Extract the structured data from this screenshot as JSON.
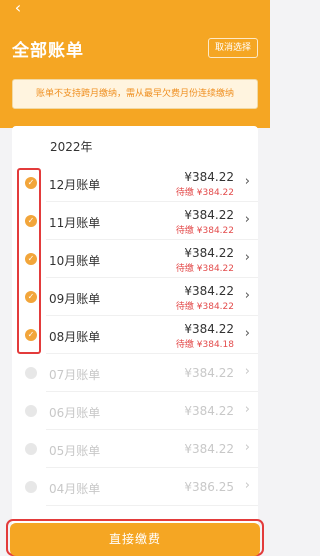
{
  "header": {
    "title": "全部账单",
    "cancel_select": "取消选择"
  },
  "notice": "账单不支持跨月缴纳，需从最早欠费月份连续缴纳",
  "year": "2022年",
  "bills": [
    {
      "month": "12月账单",
      "amount": "¥384.22",
      "due": "待缴 ¥384.22",
      "selected": true
    },
    {
      "month": "11月账单",
      "amount": "¥384.22",
      "due": "待缴 ¥384.22",
      "selected": true
    },
    {
      "month": "10月账单",
      "amount": "¥384.22",
      "due": "待缴 ¥384.22",
      "selected": true
    },
    {
      "month": "09月账单",
      "amount": "¥384.22",
      "due": "待缴 ¥384.22",
      "selected": true
    },
    {
      "month": "08月账单",
      "amount": "¥384.22",
      "due": "待缴 ¥384.18",
      "selected": true
    },
    {
      "month": "07月账单",
      "amount": "¥384.22",
      "selected": false
    },
    {
      "month": "06月账单",
      "amount": "¥384.22",
      "selected": false
    },
    {
      "month": "05月账单",
      "amount": "¥384.22",
      "selected": false
    },
    {
      "month": "04月账单",
      "amount": "¥386.25",
      "selected": false
    }
  ],
  "pay_button": "直接缴费",
  "icons": {
    "back": "back-arrow-icon",
    "check": "check-circle-icon",
    "chevron": "chevron-right-icon"
  },
  "colors": {
    "accent": "#f5a623",
    "due": "#e34b4b",
    "highlight": "#e33b3b"
  }
}
